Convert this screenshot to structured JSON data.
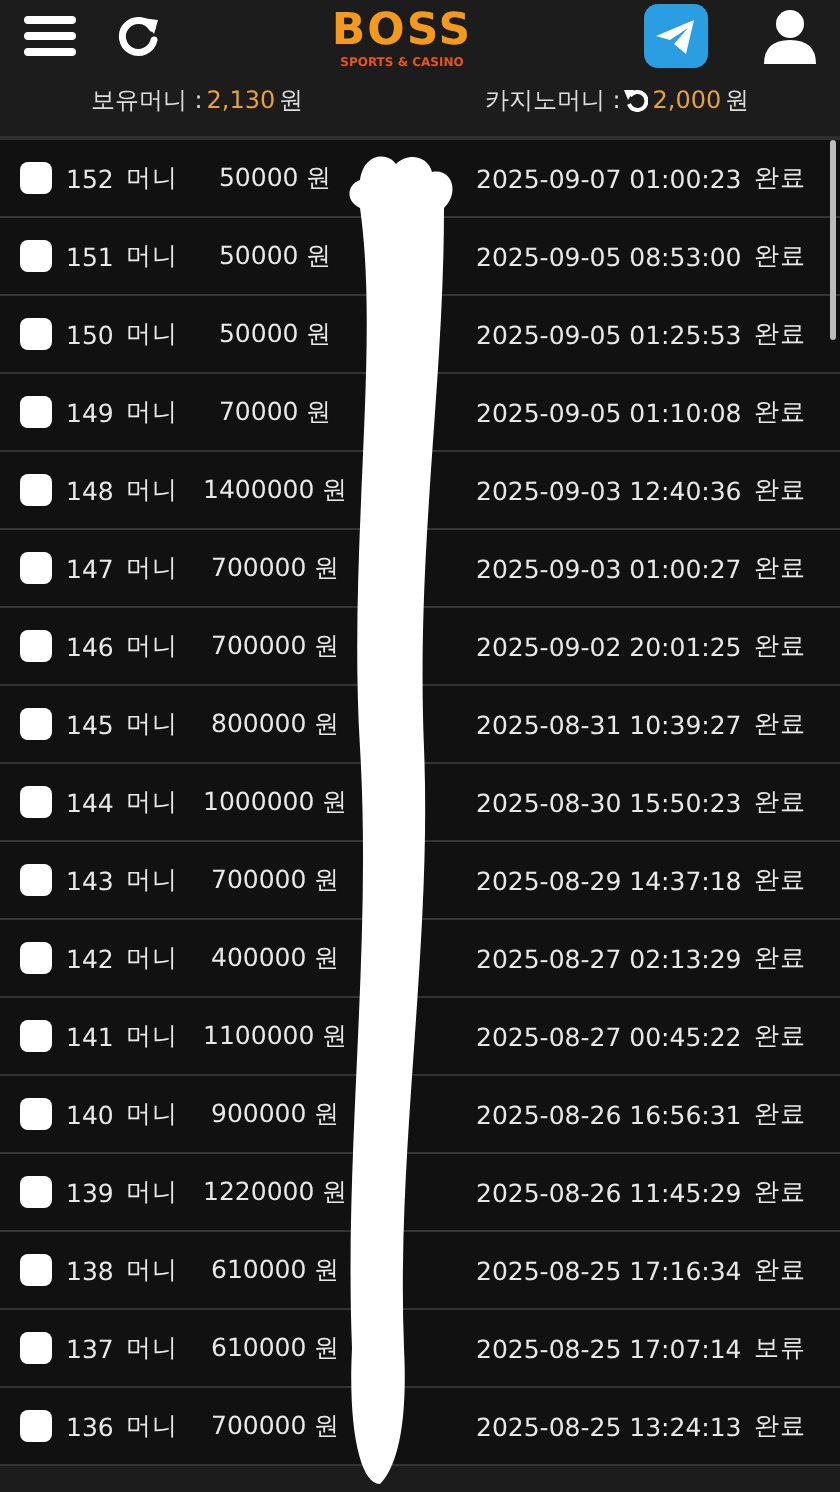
{
  "header": {
    "logo": "BOSS",
    "logo_sub": "SPORTS & CASINO"
  },
  "balances": [
    {
      "label": "보유머니 : ",
      "amount": "2,130",
      "unit": " 원",
      "refresh": false
    },
    {
      "label": "카지노머니 : ",
      "amount": "2,000",
      "unit": " 원",
      "refresh": true
    }
  ],
  "rows": [
    {
      "checked": false,
      "id": "152",
      "type": "머니",
      "amount": "50000 원",
      "date": "2025-09-07 01:00:23",
      "status": "완료"
    },
    {
      "checked": false,
      "id": "151",
      "type": "머니",
      "amount": "50000 원",
      "date": "2025-09-05 08:53:00",
      "status": "완료"
    },
    {
      "checked": false,
      "id": "150",
      "type": "머니",
      "amount": "50000 원",
      "date": "2025-09-05 01:25:53",
      "status": "완료"
    },
    {
      "checked": false,
      "id": "149",
      "type": "머니",
      "amount": "70000 원",
      "date": "2025-09-05 01:10:08",
      "status": "완료"
    },
    {
      "checked": false,
      "id": "148",
      "type": "머니",
      "amount": "1400000 원",
      "date": "2025-09-03 12:40:36",
      "status": "완료"
    },
    {
      "checked": false,
      "id": "147",
      "type": "머니",
      "amount": "700000 원",
      "date": "2025-09-03 01:00:27",
      "status": "완료"
    },
    {
      "checked": false,
      "id": "146",
      "type": "머니",
      "amount": "700000 원",
      "date": "2025-09-02 20:01:25",
      "status": "완료"
    },
    {
      "checked": false,
      "id": "145",
      "type": "머니",
      "amount": "800000 원",
      "date": "2025-08-31 10:39:27",
      "status": "완료"
    },
    {
      "checked": false,
      "id": "144",
      "type": "머니",
      "amount": "1000000 원",
      "date": "2025-08-30 15:50:23",
      "status": "완료"
    },
    {
      "checked": false,
      "id": "143",
      "type": "머니",
      "amount": "700000 원",
      "date": "2025-08-29 14:37:18",
      "status": "완료"
    },
    {
      "checked": false,
      "id": "142",
      "type": "머니",
      "amount": "400000 원",
      "date": "2025-08-27 02:13:29",
      "status": "완료"
    },
    {
      "checked": false,
      "id": "141",
      "type": "머니",
      "amount": "1100000 원",
      "date": "2025-08-27 00:45:22",
      "status": "완료"
    },
    {
      "checked": false,
      "id": "140",
      "type": "머니",
      "amount": "900000 원",
      "date": "2025-08-26 16:56:31",
      "status": "완료"
    },
    {
      "checked": false,
      "id": "139",
      "type": "머니",
      "amount": "1220000 원",
      "date": "2025-08-26 11:45:29",
      "status": "완료"
    },
    {
      "checked": false,
      "id": "138",
      "type": "머니",
      "amount": "610000 원",
      "date": "2025-08-25 17:16:34",
      "status": "완료"
    },
    {
      "checked": false,
      "id": "137",
      "type": "머니",
      "amount": "610000 원",
      "date": "2025-08-25 17:07:14",
      "status": "보류"
    },
    {
      "checked": false,
      "id": "136",
      "type": "머니",
      "amount": "700000 원",
      "date": "2025-08-25 13:24:13",
      "status": "완료"
    }
  ]
}
